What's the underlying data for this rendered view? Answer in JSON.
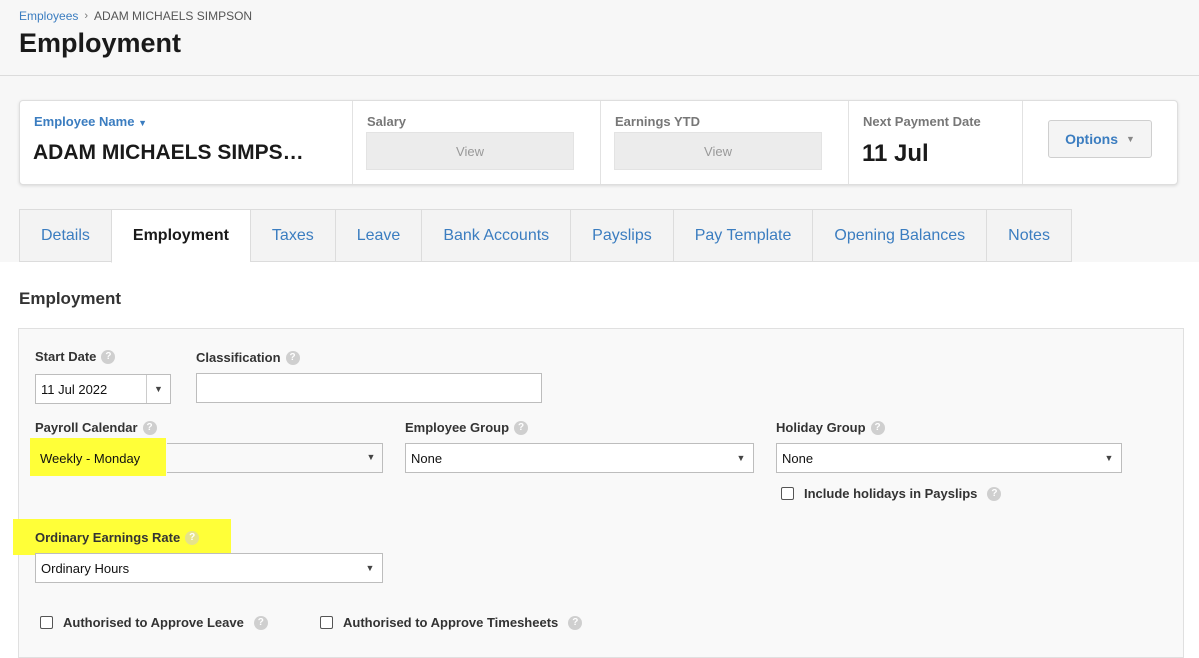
{
  "breadcrumb": {
    "parent": "Employees",
    "separator": "›",
    "current": "ADAM MICHAELS SIMPSON"
  },
  "page": {
    "title": "Employment"
  },
  "summary": {
    "employee_name_label": "Employee Name",
    "employee_name_caret": "▼",
    "employee_name": "ADAM MICHAELS SIMPS…",
    "salary_label": "Salary",
    "salary_button": "View",
    "earnings_label": "Earnings YTD",
    "earnings_button": "View",
    "next_payment_label": "Next Payment Date",
    "next_payment_value": "11 Jul",
    "options_label": "Options",
    "options_caret": "▼"
  },
  "tabs": [
    {
      "label": "Details"
    },
    {
      "label": "Employment"
    },
    {
      "label": "Taxes"
    },
    {
      "label": "Leave"
    },
    {
      "label": "Bank Accounts"
    },
    {
      "label": "Payslips"
    },
    {
      "label": "Pay Template"
    },
    {
      "label": "Opening Balances"
    },
    {
      "label": "Notes"
    }
  ],
  "active_tab": "Employment",
  "section": {
    "title": "Employment"
  },
  "form": {
    "start_date": {
      "label": "Start Date",
      "value": "11 Jul 2022"
    },
    "classification": {
      "label": "Classification",
      "value": ""
    },
    "payroll_calendar": {
      "label": "Payroll Calendar",
      "value": "Weekly - Monday"
    },
    "employee_group": {
      "label": "Employee Group",
      "value": "None"
    },
    "holiday_group": {
      "label": "Holiday Group",
      "value": "None"
    },
    "include_holidays": {
      "label": "Include holidays in Payslips",
      "checked": false
    },
    "ordinary_earnings_rate": {
      "label": "Ordinary Earnings Rate",
      "value": "Ordinary Hours"
    },
    "approve_leave": {
      "label": "Authorised to Approve Leave",
      "checked": false
    },
    "approve_timesheets": {
      "label": "Authorised to Approve Timesheets",
      "checked": false
    }
  },
  "icons": {
    "help": "question-circle-icon",
    "dropdown": "caret-down-icon"
  },
  "colors": {
    "link": "#3b7dc0",
    "highlight": "#ffff38",
    "help_icon": "#cfcfcf"
  }
}
